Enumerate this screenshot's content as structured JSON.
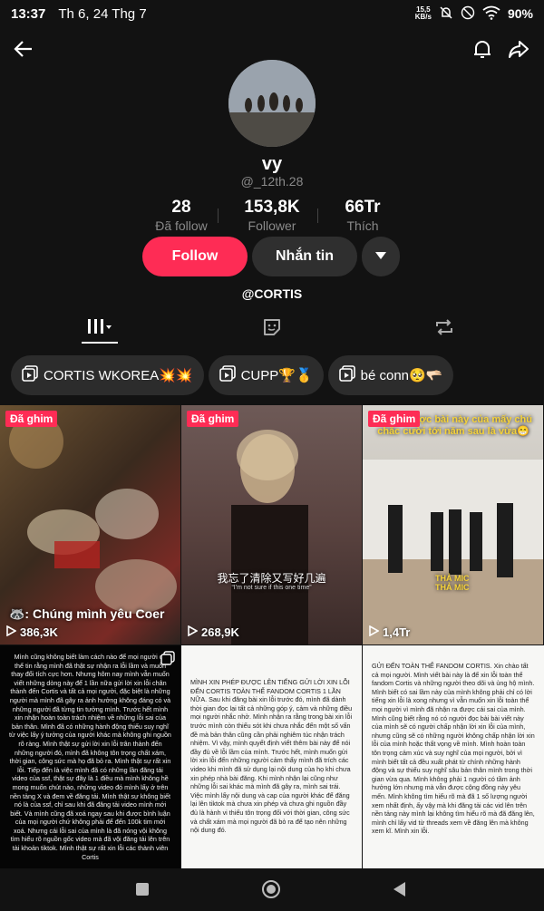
{
  "status_bar": {
    "time": "13:37",
    "date": "Th 6, 24 Thg 7",
    "net_speed_value": "15,5",
    "net_speed_unit": "KB/s",
    "battery": "90%"
  },
  "profile": {
    "display_name": "vy",
    "username": "@_12th.28",
    "stats": [
      {
        "value": "28",
        "label": "Đã follow"
      },
      {
        "value": "153,8K",
        "label": "Follower"
      },
      {
        "value": "66Tr",
        "label": "Thích"
      }
    ],
    "follow_label": "Follow",
    "message_label": "Nhắn tin",
    "bio_handle": "@CORTIS"
  },
  "playlists": [
    {
      "label": "CORTIS WKOREA💥💥"
    },
    {
      "label": "CUPP🏆🥇"
    },
    {
      "label": "bé conn🥺🫳🏻"
    }
  ],
  "videos": [
    {
      "pinned_label": "Đã ghim",
      "views": "386,3K",
      "caption": "🦝: Chúng mình yêu Coer"
    },
    {
      "pinned_label": "Đã ghim",
      "views": "268,9K",
      "caption": "我忘了清除又写好几遍",
      "subcaption": "“I'm not sure if this one time”"
    },
    {
      "pinned_label": "Đã ghim",
      "views": "1,4Tr",
      "caption": "Tuyển được bài này của mấy chú chắc cười tới năm sau là vừa😁",
      "overlay_small": "THẢ MIC THẢ MIC"
    },
    {
      "doc_text": "Mình cũng không biết làm cách nào để mọi người có thể tin rằng mình đã thật sự nhận ra lỗi lầm và muốn thay đổi tích cực hơn. Nhưng hôm nay mình vẫn muốn viết những dòng này để 1 lần nữa gửi lời xin lỗi chân thành đến Cortis và tất cả mọi người, đặc biệt là những người mà mình đã gây ra ảnh hưởng không đáng có và những người đã từng tin tưởng mình. Trước hết mình xin nhận hoàn toàn trách nhiệm về những lỗi sai của bản thân. Mình đã có những hành động thiếu suy nghĩ từ việc lấy ý tưởng của người khác mà không ghi nguồn rõ ràng. Mình thật sự gửi lời xin lỗi trân thành đến những người đó, mình đã không tôn trọng chất xám, thời gian, công sức mà họ đã bỏ ra. Mình thật sự rất xin lỗi. Tiếp đến là việc mình đã có những lần đăng tải video của ssf, thật sự đây là 1 điều mà mình không hề mong muốn chút nào, những video đó mình lấy ở trên nền tảng X và đem về đăng tải. Mình thật sự không biết nó là của ssf, chỉ sau khi đã đăng tải video mình mới biết. Và mình cũng đã xoá ngay sau khi được bình luận của mọi người chứ không phải để đến 100k tim mới xoá. Nhưng cái lỗi sai của mình là đã nóng vội không tìm hiểu rõ nguồn gốc video mà đã vội đăng tải lên trên tài khoản tiktok. Mình thật sự rất xin lỗi các thành viên Cortis"
    },
    {
      "doc_text": "MÌNH XIN PHÉP ĐƯỢC LÊN TIẾNG GỬI LỜI XIN LỖI ĐẾN CORTIS TOÀN THỂ FANDOM CORTIS 1 LẦN NỮA. Sau khi đăng bài xin lỗi trước đó, mình đã dành thời gian đọc lại tất cả những góp ý, cảm và những điều mọi người nhắc nhở. Mình nhận ra rằng trong bài xin lỗi trước mình còn thiếu sót khi chưa nhắc đến một số vấn đề mà bản thân cũng cần phải nghiêm túc nhận trách nhiệm. Vì vậy, mình quyết định viết thêm bài này để nói đầy đủ về lỗi lầm của mình. Trước hết, mình muốn gửi lời xin lỗi đến những người cảm thấy mình đã trích các video khi mình đã sử dụng lại nội dung của họ khi chưa xin phép nhà bài đăng. Khi mình nhận lại cũng như những lỗi sai khác mà mình đã gây ra, mình sai trái. Việc mình lấy nội dung và cap của người khác để đăng lại lên tiktok mà chưa xin phép và chưa ghi nguồn đầy đủ là hành vi thiếu tôn trọng đối với thời gian, công sức và chất xám mà mọi người đã bỏ ra để tạo nên những nội dung đó."
    },
    {
      "doc_text": "GỬI ĐẾN TOÀN THỂ FANDOM CORTIS. Xin chào tất cả mọi người. Mình viết bài này là để xin lỗi toàn thể fandom Cortis và những người theo dõi và ủng hộ mình. Mình biết có sai lầm này của mình không phải chỉ có lời tiếng xin lỗi là xong nhưng vì vẫn muốn xin lỗi toàn thể mọi người vì mình đã nhận ra được cái sai của mình. Mình cũng biết rằng nó có người đọc bài bài viết này của mình sẽ có người chấp nhận lời xin lỗi của mình, nhưng cũng sẽ có những người không chấp nhận lời xin lỗi của mình hoặc thất vọng về mình. Mình hoàn toàn tôn trọng cảm xúc và suy nghĩ của mọi người, bởi vì mình biết tất cả đều xuất phát từ chính những hành động và sự thiếu suy nghĩ sâu bản thân mình trong thời gian vừa qua. Mình không phải 1 người có tầm ảnh hưởng lớn nhưng mà vẫn được cộng đồng này yêu mến. Mình không tìm hiểu rõ mà đã 1 số lượng người xem nhất định, ấy vậy mà khi đăng tải các vid lên trên nền tảng này mình lại không tìm hiểu rõ mà đã đăng lên, mình chỉ lấy vid từ threads xem về đăng lên mà không xem kĩ. Mình xin lỗi."
    }
  ]
}
